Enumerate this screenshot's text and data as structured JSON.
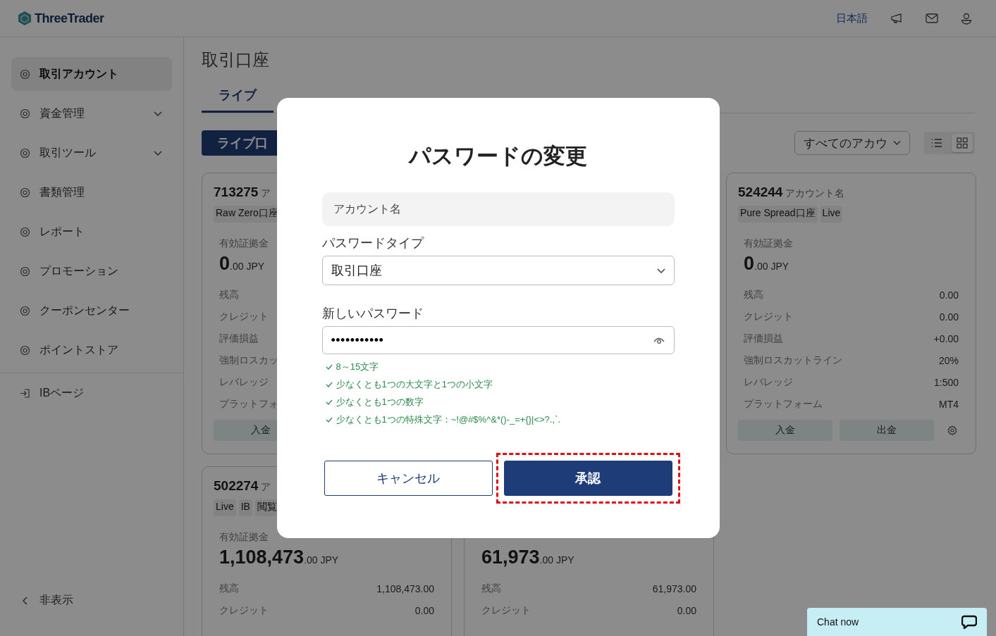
{
  "header": {
    "brand": "ThreeTrader",
    "language": "日本語"
  },
  "sidebar": {
    "items": [
      {
        "label": "取引アカウント",
        "selected": true,
        "expandable": false
      },
      {
        "label": "資金管理",
        "selected": false,
        "expandable": true
      },
      {
        "label": "取引ツール",
        "selected": false,
        "expandable": true
      },
      {
        "label": "書類管理",
        "selected": false,
        "expandable": false
      },
      {
        "label": "レポート",
        "selected": false,
        "expandable": false
      },
      {
        "label": "プロモーション",
        "selected": false,
        "expandable": false
      },
      {
        "label": "クーポンセンター",
        "selected": false,
        "expandable": false
      },
      {
        "label": "ポイントストア",
        "selected": false,
        "expandable": false
      }
    ],
    "secondary_items": [
      {
        "label": "IBページ",
        "selected": false
      }
    ],
    "collapse": "非表示"
  },
  "page": {
    "title": "取引口座",
    "tabs": [
      {
        "label": "ライブ",
        "selected": true
      }
    ],
    "create_button": "ライブ口",
    "filter": "すべてのアカウ",
    "views": [
      {
        "kind": "list",
        "selected": false
      },
      {
        "kind": "grid",
        "selected": true
      }
    ],
    "cards": [
      {
        "number": "713275",
        "name": "ア",
        "tags": [
          "Raw Zero口座"
        ],
        "margin_label": "有効証拠金",
        "amount_main": "0",
        "amount_rest": ".00 JPY",
        "rows": [
          {
            "label": "残高"
          },
          {
            "label": "クレジット"
          },
          {
            "label": "評価損益"
          },
          {
            "label": "強制ロスカッ"
          },
          {
            "label": "レバレッジ"
          },
          {
            "label": "プラットフォ"
          }
        ],
        "actions": [
          "入金"
        ]
      },
      {
        "number": "524244",
        "name": "アカウント名",
        "tags": [
          "Pure Spread口座",
          "Live"
        ],
        "margin_label": "有効証拠金",
        "amount_main": "0",
        "amount_rest": ".00 JPY",
        "rows": [
          {
            "label": "残高",
            "value": "0.00"
          },
          {
            "label": "クレジット",
            "value": "0.00"
          },
          {
            "label": "評価損益",
            "value": "+0.00"
          },
          {
            "label": "強制ロスカットライン",
            "value": "20%"
          },
          {
            "label": "レバレッジ",
            "value": "1:500"
          },
          {
            "label": "プラットフォーム",
            "value": "MT4"
          }
        ],
        "actions": [
          "入金",
          "出金"
        ],
        "settings": true
      },
      {
        "number": "502274",
        "name": "ア",
        "tags": [
          "Live",
          "IB",
          "閲覧"
        ],
        "margin_label": "有効証拠金",
        "amount_main": "1,108,473",
        "amount_rest": ".00 JPY",
        "rows": [
          {
            "label": "残高",
            "value": "1,108,473.00"
          },
          {
            "label": "クレジット",
            "value": "0.00"
          }
        ]
      },
      {
        "amount_main": "61,973",
        "amount_rest": ".00 JPY",
        "rows": [
          {
            "label": "残高",
            "value": "61,973.00"
          },
          {
            "label": "クレジット",
            "value": "0.00"
          }
        ]
      }
    ]
  },
  "dialog": {
    "title": "パスワードの変更",
    "account_field": {
      "placeholder": "アカウント名"
    },
    "type_label": "パスワードタイプ",
    "type_value": "取引口座",
    "password_label": "新しいパスワード",
    "password_value": "•••••••••••",
    "rules": [
      {
        "text": "8～15文字",
        "met": true
      },
      {
        "text": "少なくとも1つの大文字と1つの小文字",
        "met": true
      },
      {
        "text": "少なくとも1つの数字",
        "met": true
      },
      {
        "text": "少なくとも1つの特殊文字：~!@#$%^&*()-_=+{}|<>?.,`.",
        "met": true
      }
    ],
    "buttons": [
      {
        "label": "キャンセル",
        "kind": "secondary",
        "highlighted": false
      },
      {
        "label": "承認",
        "kind": "primary",
        "highlighted": true
      }
    ]
  },
  "chat": {
    "label": "Chat now"
  }
}
